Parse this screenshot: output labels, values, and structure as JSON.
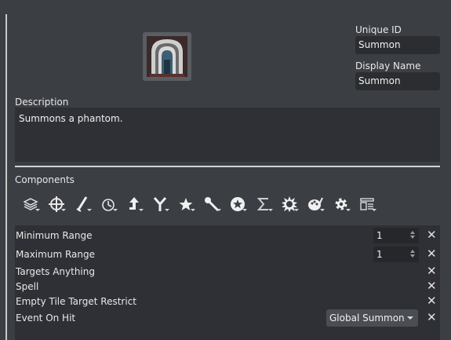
{
  "identity": {
    "unique_id_label": "Unique ID",
    "unique_id_value": "Summon",
    "display_name_label": "Display Name",
    "display_name_value": "Summon",
    "icon": "archway-portal-icon"
  },
  "description": {
    "label": "Description",
    "text": "Summons a phantom."
  },
  "components": {
    "label": "Components",
    "toolbar_icons": [
      "layers-icon",
      "crosshair-icon",
      "sword-icon",
      "clock-arrow-icon",
      "arrow-up-icon",
      "fork-icon",
      "star-icon",
      "wand-icon",
      "star-badge-icon",
      "sigma-icon",
      "burst-icon",
      "palette-icon",
      "gear-icon",
      "layout-icon"
    ],
    "rows": [
      {
        "label": "Minimum Range",
        "value": "1"
      },
      {
        "label": "Maximum Range",
        "value": "1"
      },
      {
        "label": "Targets Anything"
      },
      {
        "label": "Spell"
      },
      {
        "label": "Empty Tile Target Restrict"
      },
      {
        "label": "Event On Hit",
        "select": "Global Summon"
      }
    ],
    "remove_symbol": "✕"
  }
}
